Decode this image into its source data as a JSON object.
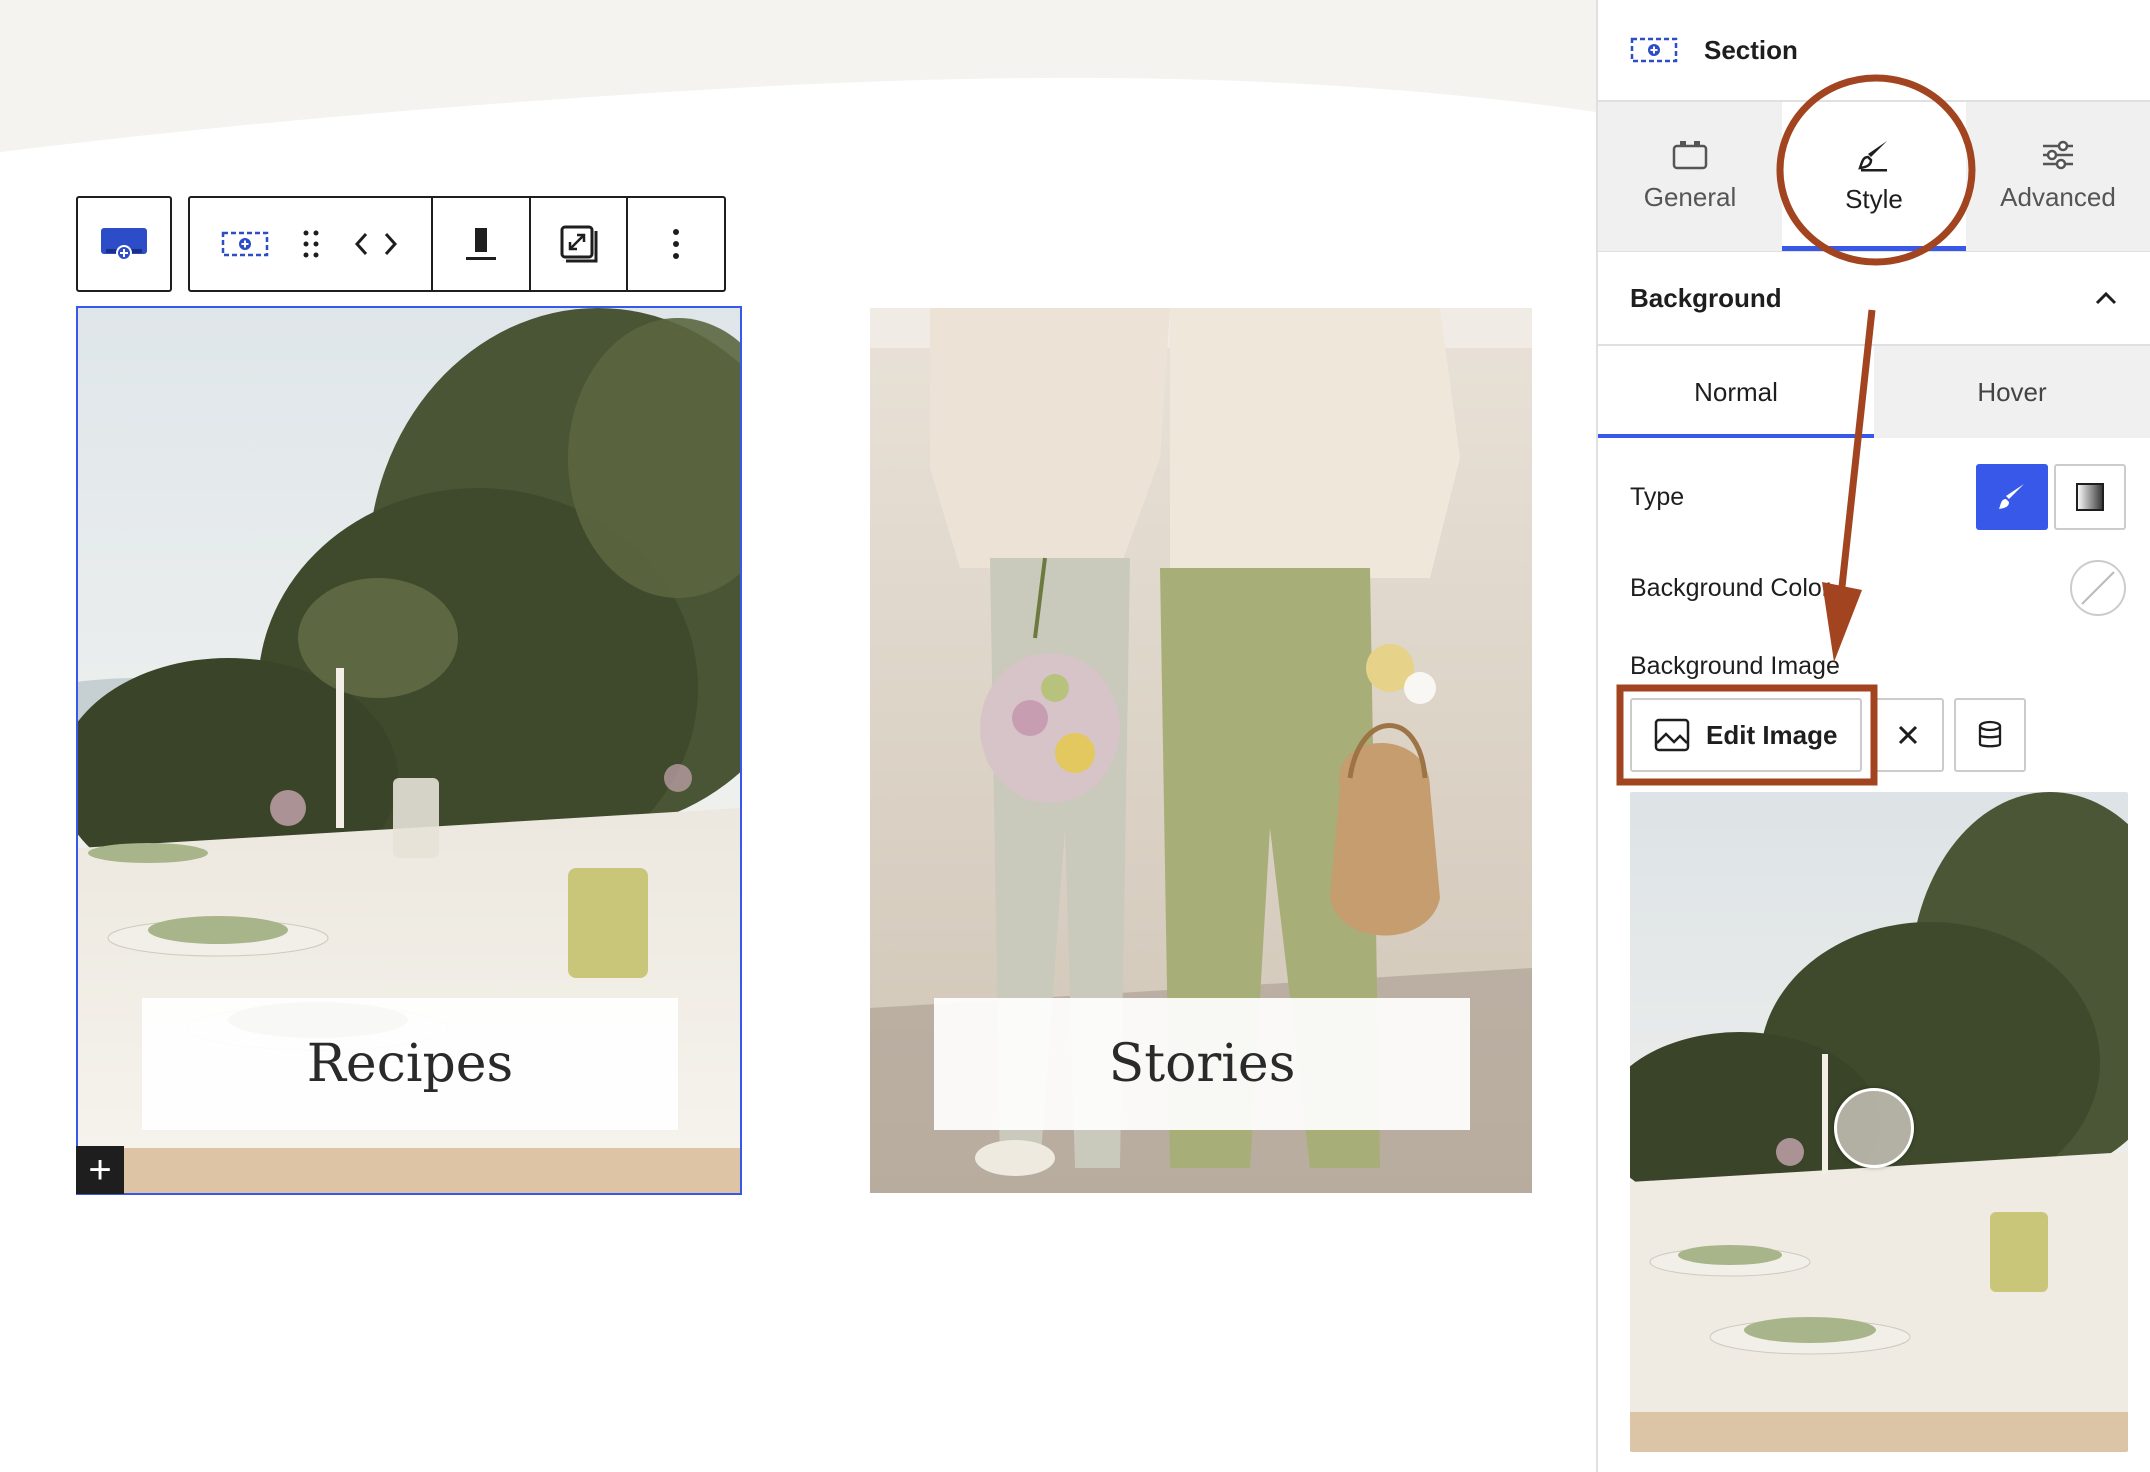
{
  "canvas": {
    "cards": [
      {
        "label": "Recipes",
        "selected": true
      },
      {
        "label": "Stories",
        "selected": false
      }
    ],
    "toolbar": {
      "icons": [
        "section-block-icon",
        "section-icon",
        "drag-handle-icon",
        "move-arrows-icon",
        "align-bottom-icon",
        "resize-icon",
        "more-options-icon"
      ]
    },
    "add_block_label": "+"
  },
  "sidebar": {
    "block_title": "Section",
    "tabs": [
      {
        "label": "General",
        "active": false
      },
      {
        "label": "Style",
        "active": true
      },
      {
        "label": "Advanced",
        "active": false
      }
    ],
    "panel": {
      "title": "Background",
      "state_tabs": [
        {
          "label": "Normal",
          "active": true
        },
        {
          "label": "Hover",
          "active": false
        }
      ],
      "type_label": "Type",
      "bg_color_label": "Background Color",
      "bg_image_label": "Background Image",
      "edit_image_label": "Edit Image"
    }
  },
  "colors": {
    "accent": "#3858e9",
    "annotation": "#a2441f",
    "wave": "#f5f3ef"
  }
}
